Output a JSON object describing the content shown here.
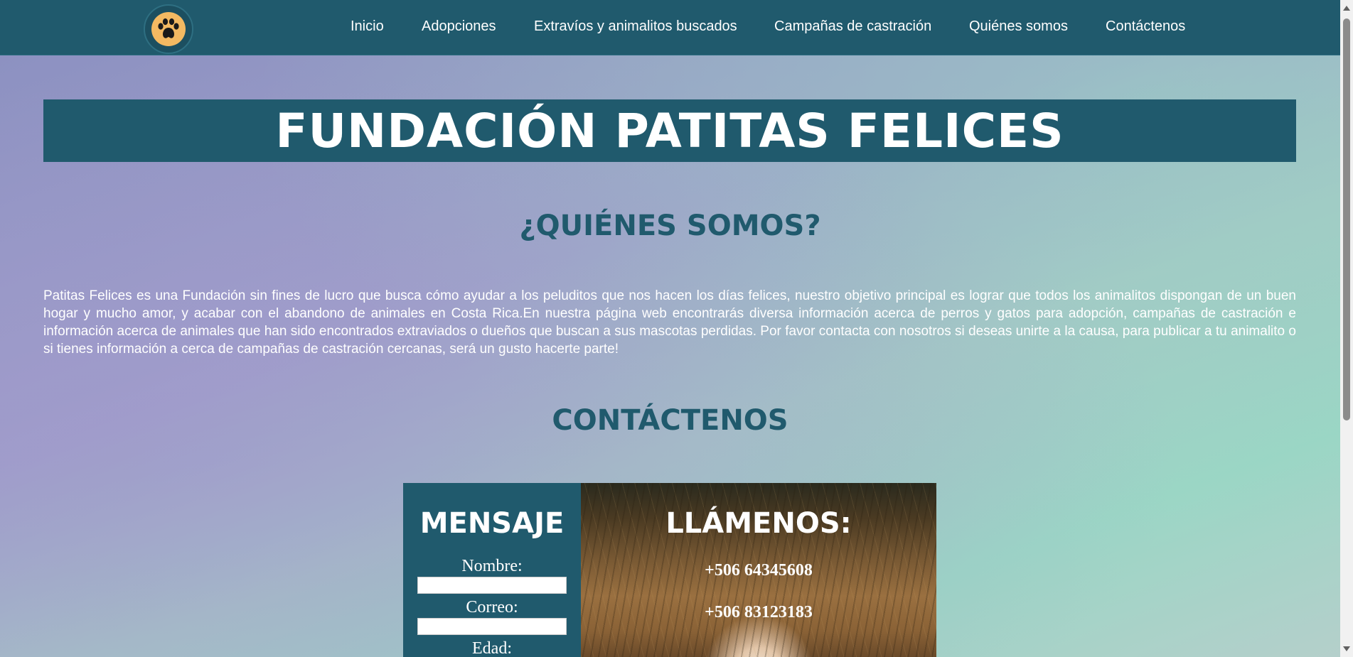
{
  "nav": {
    "logo_icon": "paw-icon",
    "items": [
      {
        "label": "Inicio"
      },
      {
        "label": "Adopciones"
      },
      {
        "label": "Extravíos y animalitos buscados"
      },
      {
        "label": "Campañas de castración"
      },
      {
        "label": "Quiénes somos"
      },
      {
        "label": "Contáctenos"
      }
    ]
  },
  "hero": {
    "title": "FUNDACIÓN PATITAS FELICES"
  },
  "about": {
    "heading": "¿QUIÉNES SOMOS?",
    "text": "Patitas Felices es una Fundación sin fines de lucro que busca cómo ayudar a los peluditos que nos hacen los días felices, nuestro objetivo principal es lograr que todos los animalitos dispongan de un buen hogar y mucho amor, y acabar con el abandono de animales en Costa Rica.En nuestra página web encontrarás diversa información acerca de perros y gatos para adopción, campañas de castración e información acerca de animales que han sido encontrados extraviados o dueños que buscan a sus mascotas perdidas. Por favor contacta con nosotros si deseas unirte a la causa, para publicar a tu animalito o si tienes información a cerca de campañas de castración cercanas, será un gusto hacerte parte!"
  },
  "contact": {
    "heading": "CONTÁCTENOS",
    "message_panel": {
      "title": "MENSAJE",
      "name_label": "Nombre:",
      "name_value": "",
      "email_label": "Correo:",
      "email_value": "",
      "age_label": "Edad:"
    },
    "call_panel": {
      "title": "LLÁMENOS:",
      "phones": [
        "+506 64345608",
        "+506 83123183"
      ]
    }
  },
  "colors": {
    "primary": "#205a6d",
    "text_light": "#ffffff",
    "logo_accent": "#f3b962"
  }
}
